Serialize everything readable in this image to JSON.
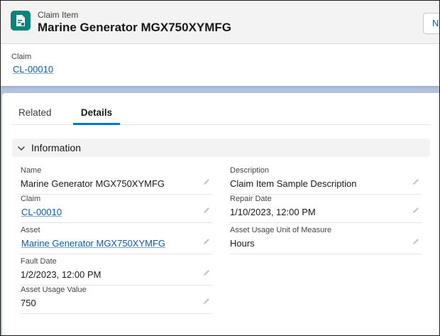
{
  "header": {
    "object_type": "Claim Item",
    "record_name": "Marine Generator MGX750XYMFG",
    "new_button_label": "New",
    "icon": "claim-item-icon"
  },
  "highlights": {
    "label": "Claim",
    "value": "CL-00010"
  },
  "tabs": [
    {
      "label": "Related",
      "active": false
    },
    {
      "label": "Details",
      "active": true
    }
  ],
  "section": {
    "title": "Information",
    "expanded": true
  },
  "fields_left": [
    {
      "label": "Name",
      "value": "Marine Generator MGX750XYMFG",
      "link": false
    },
    {
      "label": "Claim",
      "value": "CL-00010",
      "link": true
    },
    {
      "label": "Asset",
      "value": "Marine Generator MGX750XYMFG",
      "link": true
    },
    {
      "label": "Fault Date",
      "value": "1/2/2023, 12:00 PM",
      "link": false
    },
    {
      "label": "Asset Usage Value",
      "value": "750",
      "link": false
    }
  ],
  "fields_right": [
    {
      "label": "Description",
      "value": "Claim Item Sample Description",
      "link": false
    },
    {
      "label": "Repair Date",
      "value": "1/10/2023, 12:00 PM",
      "link": false
    },
    {
      "label": "Asset Usage Unit of Measure",
      "value": "Hours",
      "link": false
    }
  ],
  "colors": {
    "brand_icon": "#0b827c",
    "link": "#0b5cab",
    "active_tab_underline": "#0176d3",
    "backdrop": "#b0c4df"
  }
}
